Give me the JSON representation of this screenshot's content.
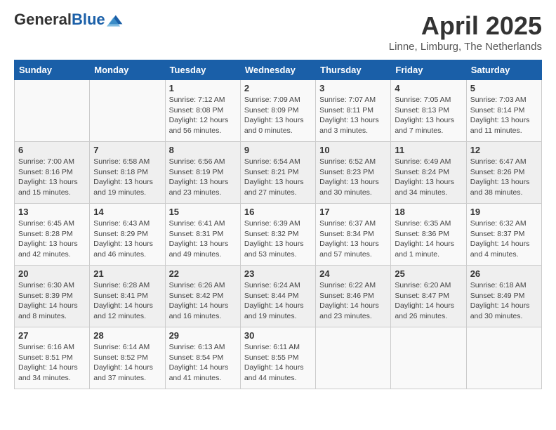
{
  "header": {
    "logo_general": "General",
    "logo_blue": "Blue",
    "main_title": "April 2025",
    "subtitle": "Linne, Limburg, The Netherlands"
  },
  "calendar": {
    "days_of_week": [
      "Sunday",
      "Monday",
      "Tuesday",
      "Wednesday",
      "Thursday",
      "Friday",
      "Saturday"
    ],
    "weeks": [
      [
        {
          "day": "",
          "info": ""
        },
        {
          "day": "",
          "info": ""
        },
        {
          "day": "1",
          "info": "Sunrise: 7:12 AM\nSunset: 8:08 PM\nDaylight: 12 hours\nand 56 minutes."
        },
        {
          "day": "2",
          "info": "Sunrise: 7:09 AM\nSunset: 8:09 PM\nDaylight: 13 hours\nand 0 minutes."
        },
        {
          "day": "3",
          "info": "Sunrise: 7:07 AM\nSunset: 8:11 PM\nDaylight: 13 hours\nand 3 minutes."
        },
        {
          "day": "4",
          "info": "Sunrise: 7:05 AM\nSunset: 8:13 PM\nDaylight: 13 hours\nand 7 minutes."
        },
        {
          "day": "5",
          "info": "Sunrise: 7:03 AM\nSunset: 8:14 PM\nDaylight: 13 hours\nand 11 minutes."
        }
      ],
      [
        {
          "day": "6",
          "info": "Sunrise: 7:00 AM\nSunset: 8:16 PM\nDaylight: 13 hours\nand 15 minutes."
        },
        {
          "day": "7",
          "info": "Sunrise: 6:58 AM\nSunset: 8:18 PM\nDaylight: 13 hours\nand 19 minutes."
        },
        {
          "day": "8",
          "info": "Sunrise: 6:56 AM\nSunset: 8:19 PM\nDaylight: 13 hours\nand 23 minutes."
        },
        {
          "day": "9",
          "info": "Sunrise: 6:54 AM\nSunset: 8:21 PM\nDaylight: 13 hours\nand 27 minutes."
        },
        {
          "day": "10",
          "info": "Sunrise: 6:52 AM\nSunset: 8:23 PM\nDaylight: 13 hours\nand 30 minutes."
        },
        {
          "day": "11",
          "info": "Sunrise: 6:49 AM\nSunset: 8:24 PM\nDaylight: 13 hours\nand 34 minutes."
        },
        {
          "day": "12",
          "info": "Sunrise: 6:47 AM\nSunset: 8:26 PM\nDaylight: 13 hours\nand 38 minutes."
        }
      ],
      [
        {
          "day": "13",
          "info": "Sunrise: 6:45 AM\nSunset: 8:28 PM\nDaylight: 13 hours\nand 42 minutes."
        },
        {
          "day": "14",
          "info": "Sunrise: 6:43 AM\nSunset: 8:29 PM\nDaylight: 13 hours\nand 46 minutes."
        },
        {
          "day": "15",
          "info": "Sunrise: 6:41 AM\nSunset: 8:31 PM\nDaylight: 13 hours\nand 49 minutes."
        },
        {
          "day": "16",
          "info": "Sunrise: 6:39 AM\nSunset: 8:32 PM\nDaylight: 13 hours\nand 53 minutes."
        },
        {
          "day": "17",
          "info": "Sunrise: 6:37 AM\nSunset: 8:34 PM\nDaylight: 13 hours\nand 57 minutes."
        },
        {
          "day": "18",
          "info": "Sunrise: 6:35 AM\nSunset: 8:36 PM\nDaylight: 14 hours\nand 1 minute."
        },
        {
          "day": "19",
          "info": "Sunrise: 6:32 AM\nSunset: 8:37 PM\nDaylight: 14 hours\nand 4 minutes."
        }
      ],
      [
        {
          "day": "20",
          "info": "Sunrise: 6:30 AM\nSunset: 8:39 PM\nDaylight: 14 hours\nand 8 minutes."
        },
        {
          "day": "21",
          "info": "Sunrise: 6:28 AM\nSunset: 8:41 PM\nDaylight: 14 hours\nand 12 minutes."
        },
        {
          "day": "22",
          "info": "Sunrise: 6:26 AM\nSunset: 8:42 PM\nDaylight: 14 hours\nand 16 minutes."
        },
        {
          "day": "23",
          "info": "Sunrise: 6:24 AM\nSunset: 8:44 PM\nDaylight: 14 hours\nand 19 minutes."
        },
        {
          "day": "24",
          "info": "Sunrise: 6:22 AM\nSunset: 8:46 PM\nDaylight: 14 hours\nand 23 minutes."
        },
        {
          "day": "25",
          "info": "Sunrise: 6:20 AM\nSunset: 8:47 PM\nDaylight: 14 hours\nand 26 minutes."
        },
        {
          "day": "26",
          "info": "Sunrise: 6:18 AM\nSunset: 8:49 PM\nDaylight: 14 hours\nand 30 minutes."
        }
      ],
      [
        {
          "day": "27",
          "info": "Sunrise: 6:16 AM\nSunset: 8:51 PM\nDaylight: 14 hours\nand 34 minutes."
        },
        {
          "day": "28",
          "info": "Sunrise: 6:14 AM\nSunset: 8:52 PM\nDaylight: 14 hours\nand 37 minutes."
        },
        {
          "day": "29",
          "info": "Sunrise: 6:13 AM\nSunset: 8:54 PM\nDaylight: 14 hours\nand 41 minutes."
        },
        {
          "day": "30",
          "info": "Sunrise: 6:11 AM\nSunset: 8:55 PM\nDaylight: 14 hours\nand 44 minutes."
        },
        {
          "day": "",
          "info": ""
        },
        {
          "day": "",
          "info": ""
        },
        {
          "day": "",
          "info": ""
        }
      ]
    ]
  }
}
